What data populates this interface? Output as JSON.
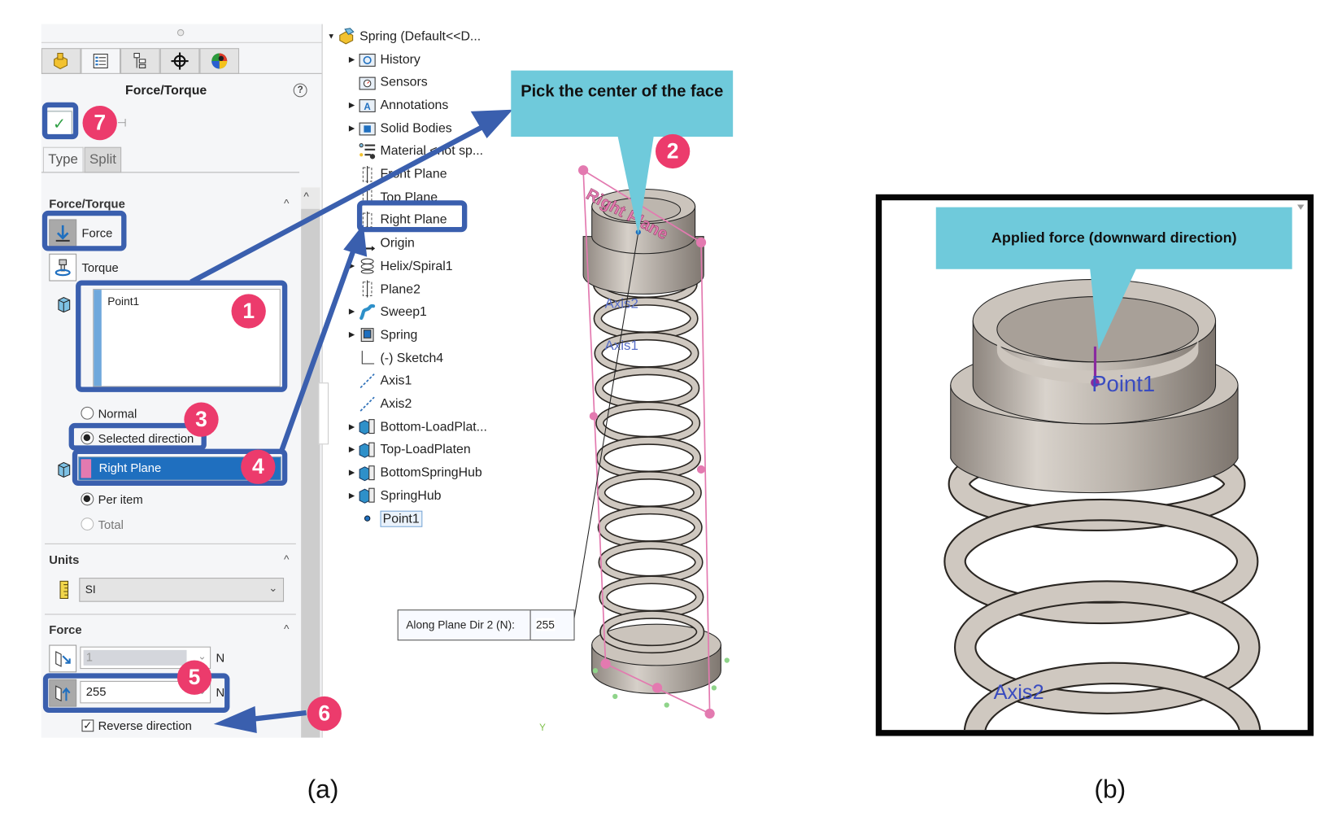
{
  "panel": {
    "title": "Force/Torque",
    "help": "?",
    "ok_symbol": "✓",
    "tabs": [
      "Type",
      "Split"
    ],
    "active_tab": "Type",
    "manager_tabs": [
      "feature-manager",
      "property-manager",
      "configuration-manager",
      "dimxpert-manager",
      "display-manager"
    ],
    "section_force_torque": {
      "title": "Force/Torque",
      "options": [
        {
          "label": "Force",
          "selected": true
        },
        {
          "label": "Torque",
          "selected": false
        }
      ],
      "selection_list": [
        "Point1"
      ],
      "direction_options": [
        {
          "label": "Normal",
          "checked": false
        },
        {
          "label": "Selected direction",
          "checked": true
        }
      ],
      "direction_reference": "Right Plane",
      "distribution_options": [
        {
          "label": "Per item",
          "checked": true,
          "enabled": true
        },
        {
          "label": "Total",
          "checked": false,
          "enabled": false
        }
      ]
    },
    "section_units": {
      "title": "Units",
      "value": "SI"
    },
    "section_force": {
      "title": "Force",
      "dir1_value": "1",
      "dir2_value": "255",
      "unit": "N",
      "reverse_direction_label": "Reverse direction",
      "reverse_direction_checked": true
    }
  },
  "tree": {
    "root": "Spring  (Default<<D...",
    "items": [
      {
        "label": "History",
        "icon": "history-folder-icon",
        "expandable": true
      },
      {
        "label": "Sensors",
        "icon": "sensors-folder-icon",
        "expandable": false
      },
      {
        "label": "Annotations",
        "icon": "annotations-folder-icon",
        "expandable": true
      },
      {
        "label": "Solid Bodies",
        "icon": "solid-bodies-folder-icon",
        "expandable": true
      },
      {
        "label": "Material <not sp...",
        "icon": "material-icon",
        "expandable": false
      },
      {
        "label": "Front Plane",
        "icon": "plane-icon",
        "expandable": false
      },
      {
        "label": "Top Plane",
        "icon": "plane-icon",
        "expandable": false
      },
      {
        "label": "Right Plane",
        "icon": "plane-icon",
        "expandable": false
      },
      {
        "label": "Origin",
        "icon": "origin-icon",
        "expandable": false
      },
      {
        "label": "Helix/Spiral1",
        "icon": "helix-icon",
        "expandable": true
      },
      {
        "label": "Plane2",
        "icon": "plane-icon",
        "expandable": false
      },
      {
        "label": "Sweep1",
        "icon": "sweep-icon",
        "expandable": true
      },
      {
        "label": "Spring",
        "icon": "part-icon",
        "expandable": true
      },
      {
        "label": "(-) Sketch4",
        "icon": "sketch-icon",
        "expandable": false
      },
      {
        "label": "Axis1",
        "icon": "axis-icon",
        "expandable": false
      },
      {
        "label": "Axis2",
        "icon": "axis-icon",
        "expandable": false
      },
      {
        "label": "Bottom-LoadPlat...",
        "icon": "component-icon",
        "expandable": true
      },
      {
        "label": "Top-LoadPlaten",
        "icon": "component-icon",
        "expandable": true
      },
      {
        "label": "BottomSpringHub",
        "icon": "component-icon",
        "expandable": true
      },
      {
        "label": "SpringHub",
        "icon": "component-icon",
        "expandable": true
      },
      {
        "label": "Point1",
        "icon": "point-icon",
        "expandable": false,
        "selected": true
      }
    ]
  },
  "viewport": {
    "plane_label": "Right Plane",
    "point_label": "Point1",
    "axis_labels": [
      "Axis2",
      "Axis1"
    ],
    "triad_label": "Y",
    "dimension_box": {
      "label": "Along Plane Dir 2 (N):",
      "value": "255"
    }
  },
  "callouts": {
    "pick_center": "Pick the center of the face",
    "applied_force": "Applied force (downward direction)",
    "badges": [
      "1",
      "2",
      "3",
      "4",
      "5",
      "6",
      "7"
    ]
  },
  "detail_view": {
    "point_label": "Point1",
    "axis_label": "Axis2"
  },
  "captions": {
    "a": "(a)",
    "b": "(b)"
  },
  "colors": {
    "annotation_blue": "#3a5fae",
    "badge_pink": "#ec3b6c",
    "tip_cyan": "#6fcadb",
    "plane_pink": "#e37ab0",
    "selection_blue": "#1f6fbf",
    "spring_gray": "#cfc8c0"
  }
}
